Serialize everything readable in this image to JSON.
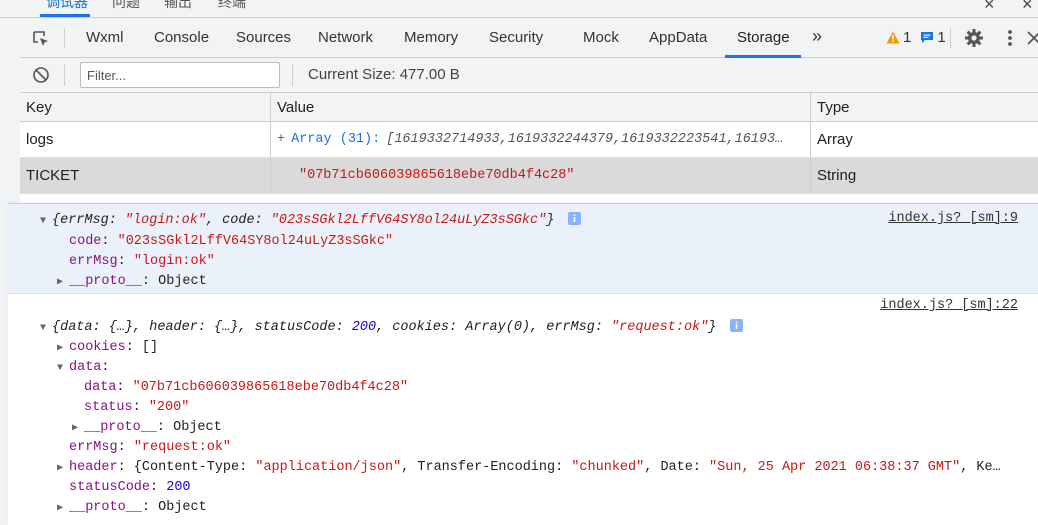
{
  "top_tabs": [
    "调试器",
    "问题",
    "输出",
    "终端"
  ],
  "tabs": [
    "Wxml",
    "Console",
    "Sources",
    "Network",
    "Memory",
    "Security",
    "Mock",
    "AppData",
    "Storage"
  ],
  "active_tab": "Storage",
  "more_tabs_glyph": "»",
  "badges": {
    "warnings": "1",
    "messages": "1"
  },
  "toolbar": {
    "filter_placeholder": "Filter...",
    "filter_value": "",
    "current_size": "Current Size:  477.00 B"
  },
  "table": {
    "headers": {
      "key": "Key",
      "value": "Value",
      "type": "Type"
    },
    "rows": [
      {
        "key": "logs",
        "value_plus": "+",
        "value_type": "Array (31):",
        "value_items": "[1619332714933,1619332244379,1619332223541,16193…",
        "type": "Array"
      },
      {
        "key": "TICKET",
        "value": "\"07b71cb606039865618ebe70db4f4c28\"",
        "type": "String"
      }
    ]
  },
  "console": {
    "msg1": {
      "source": "index.js? [sm]:9",
      "summary": {
        "open": "{",
        "k1": "errMsg",
        "v1": "\"login:ok\"",
        "sep": ", ",
        "k2": "code",
        "v2": "\"023sSGkl2LffV64SY8ol24uLyZ3sSGkc\"",
        "close": "}"
      },
      "props": [
        {
          "key": "code",
          "value": "\"023sSGkl2LffV64SY8ol24uLyZ3sSGkc\""
        },
        {
          "key": "errMsg",
          "value": "\"login:ok\""
        }
      ],
      "proto": {
        "key": "__proto__",
        "value": "Object"
      }
    },
    "msg2": {
      "source": "index.js? [sm]:22",
      "summary": {
        "open": "{",
        "data": "data",
        "data_v": "{…}",
        "header": "header",
        "header_v": "{…}",
        "statusCode": "statusCode",
        "statusCode_v": "200",
        "cookies": "cookies",
        "cookies_v": "Array(0)",
        "errMsg": "errMsg",
        "errMsg_v": "\"request:ok\"",
        "close": "}"
      },
      "cookies": {
        "key": "cookies",
        "value": "[]"
      },
      "data": {
        "key": "data",
        "inner_data_key": "data",
        "inner_data_value": "\"07b71cb606039865618ebe70db4f4c28\"",
        "status_key": "status",
        "status_value": "\"200\"",
        "proto_key": "__proto__",
        "proto_value": "Object"
      },
      "errMsg": {
        "key": "errMsg",
        "value": "\"request:ok\""
      },
      "header": {
        "key": "header",
        "ct_key": "Content-Type",
        "ct_value": "\"application/json\"",
        "te_key": "Transfer-Encoding",
        "te_value": "\"chunked\"",
        "date_key": "Date",
        "date_value": "\"Sun, 25 Apr 2021 06:38:37 GMT\"",
        "tail": "Ke…"
      },
      "statusCode": {
        "key": "statusCode",
        "value": "200"
      },
      "proto": {
        "key": "__proto__",
        "value": "Object"
      }
    }
  },
  "colors": {
    "accent": "#1a73e8",
    "warning": "#f29900",
    "string": "#c41a16",
    "number": "#1c00cf",
    "key": "#881280",
    "selected_row": "#dadada",
    "message_bg": "#ebf1fb"
  }
}
